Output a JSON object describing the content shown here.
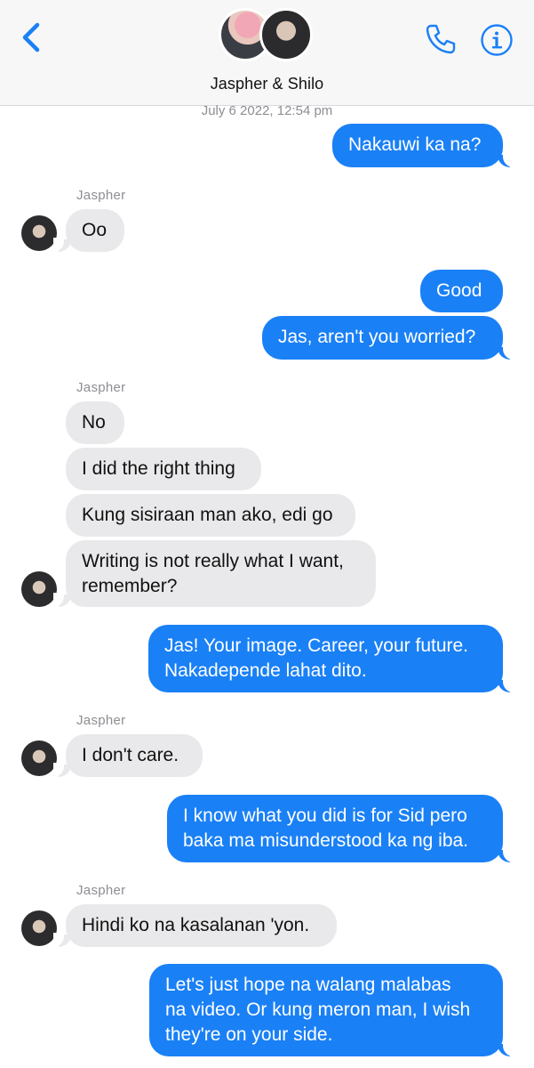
{
  "header": {
    "title": "Jaspher & Shilo",
    "back_icon": "chevron-left-icon",
    "call_icon": "phone-icon",
    "info_icon": "info-icon",
    "accent_color": "#1a80f6"
  },
  "conversation": {
    "timestamp": "July 6 2022, 12:54 pm",
    "messages": [
      {
        "from": "me",
        "text": "Nakauwi ka na?"
      },
      {
        "from": "Jaspher",
        "sender_label": "Jaspher",
        "text": "Oo"
      },
      {
        "from": "me",
        "text": "Good"
      },
      {
        "from": "me",
        "text": "Jas, aren't you worried?"
      },
      {
        "from": "Jaspher",
        "sender_label": "Jaspher",
        "text": "No"
      },
      {
        "from": "Jaspher",
        "text": "I did the right thing"
      },
      {
        "from": "Jaspher",
        "text": "Kung sisiraan man ako, edi go"
      },
      {
        "from": "Jaspher",
        "text": "Writing is not really what I want,\nremember?"
      },
      {
        "from": "me",
        "text": "Jas! Your image. Career, your future.\nNakadepende lahat dito."
      },
      {
        "from": "Jaspher",
        "sender_label": "Jaspher",
        "text": "I don't care."
      },
      {
        "from": "me",
        "text": "I know what you did is for Sid pero\nbaka ma misunderstood ka ng iba."
      },
      {
        "from": "Jaspher",
        "sender_label": "Jaspher",
        "text": "Hindi ko na kasalanan 'yon."
      },
      {
        "from": "me",
        "text": "Let's just hope na walang malabas\nna video. Or kung meron man, I wish\nthey're on your side."
      }
    ]
  },
  "colors": {
    "outgoing_bubble": "#1a80f6",
    "incoming_bubble": "#e9e9eb",
    "meta_text": "#8e8e93"
  }
}
